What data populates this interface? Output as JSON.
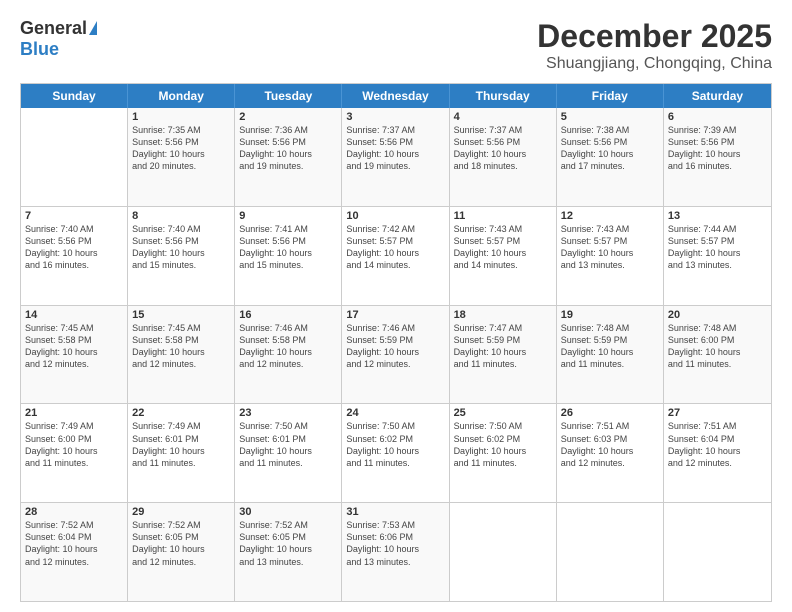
{
  "header": {
    "logo_general": "General",
    "logo_blue": "Blue",
    "month_title": "December 2025",
    "subtitle": "Shuangjiang, Chongqing, China"
  },
  "days_of_week": [
    "Sunday",
    "Monday",
    "Tuesday",
    "Wednesday",
    "Thursday",
    "Friday",
    "Saturday"
  ],
  "weeks": [
    [
      {
        "day": "",
        "info": ""
      },
      {
        "day": "1",
        "info": "Sunrise: 7:35 AM\nSunset: 5:56 PM\nDaylight: 10 hours\nand 20 minutes."
      },
      {
        "day": "2",
        "info": "Sunrise: 7:36 AM\nSunset: 5:56 PM\nDaylight: 10 hours\nand 19 minutes."
      },
      {
        "day": "3",
        "info": "Sunrise: 7:37 AM\nSunset: 5:56 PM\nDaylight: 10 hours\nand 19 minutes."
      },
      {
        "day": "4",
        "info": "Sunrise: 7:37 AM\nSunset: 5:56 PM\nDaylight: 10 hours\nand 18 minutes."
      },
      {
        "day": "5",
        "info": "Sunrise: 7:38 AM\nSunset: 5:56 PM\nDaylight: 10 hours\nand 17 minutes."
      },
      {
        "day": "6",
        "info": "Sunrise: 7:39 AM\nSunset: 5:56 PM\nDaylight: 10 hours\nand 16 minutes."
      }
    ],
    [
      {
        "day": "7",
        "info": "Sunrise: 7:40 AM\nSunset: 5:56 PM\nDaylight: 10 hours\nand 16 minutes."
      },
      {
        "day": "8",
        "info": "Sunrise: 7:40 AM\nSunset: 5:56 PM\nDaylight: 10 hours\nand 15 minutes."
      },
      {
        "day": "9",
        "info": "Sunrise: 7:41 AM\nSunset: 5:56 PM\nDaylight: 10 hours\nand 15 minutes."
      },
      {
        "day": "10",
        "info": "Sunrise: 7:42 AM\nSunset: 5:57 PM\nDaylight: 10 hours\nand 14 minutes."
      },
      {
        "day": "11",
        "info": "Sunrise: 7:43 AM\nSunset: 5:57 PM\nDaylight: 10 hours\nand 14 minutes."
      },
      {
        "day": "12",
        "info": "Sunrise: 7:43 AM\nSunset: 5:57 PM\nDaylight: 10 hours\nand 13 minutes."
      },
      {
        "day": "13",
        "info": "Sunrise: 7:44 AM\nSunset: 5:57 PM\nDaylight: 10 hours\nand 13 minutes."
      }
    ],
    [
      {
        "day": "14",
        "info": "Sunrise: 7:45 AM\nSunset: 5:58 PM\nDaylight: 10 hours\nand 12 minutes."
      },
      {
        "day": "15",
        "info": "Sunrise: 7:45 AM\nSunset: 5:58 PM\nDaylight: 10 hours\nand 12 minutes."
      },
      {
        "day": "16",
        "info": "Sunrise: 7:46 AM\nSunset: 5:58 PM\nDaylight: 10 hours\nand 12 minutes."
      },
      {
        "day": "17",
        "info": "Sunrise: 7:46 AM\nSunset: 5:59 PM\nDaylight: 10 hours\nand 12 minutes."
      },
      {
        "day": "18",
        "info": "Sunrise: 7:47 AM\nSunset: 5:59 PM\nDaylight: 10 hours\nand 11 minutes."
      },
      {
        "day": "19",
        "info": "Sunrise: 7:48 AM\nSunset: 5:59 PM\nDaylight: 10 hours\nand 11 minutes."
      },
      {
        "day": "20",
        "info": "Sunrise: 7:48 AM\nSunset: 6:00 PM\nDaylight: 10 hours\nand 11 minutes."
      }
    ],
    [
      {
        "day": "21",
        "info": "Sunrise: 7:49 AM\nSunset: 6:00 PM\nDaylight: 10 hours\nand 11 minutes."
      },
      {
        "day": "22",
        "info": "Sunrise: 7:49 AM\nSunset: 6:01 PM\nDaylight: 10 hours\nand 11 minutes."
      },
      {
        "day": "23",
        "info": "Sunrise: 7:50 AM\nSunset: 6:01 PM\nDaylight: 10 hours\nand 11 minutes."
      },
      {
        "day": "24",
        "info": "Sunrise: 7:50 AM\nSunset: 6:02 PM\nDaylight: 10 hours\nand 11 minutes."
      },
      {
        "day": "25",
        "info": "Sunrise: 7:50 AM\nSunset: 6:02 PM\nDaylight: 10 hours\nand 11 minutes."
      },
      {
        "day": "26",
        "info": "Sunrise: 7:51 AM\nSunset: 6:03 PM\nDaylight: 10 hours\nand 12 minutes."
      },
      {
        "day": "27",
        "info": "Sunrise: 7:51 AM\nSunset: 6:04 PM\nDaylight: 10 hours\nand 12 minutes."
      }
    ],
    [
      {
        "day": "28",
        "info": "Sunrise: 7:52 AM\nSunset: 6:04 PM\nDaylight: 10 hours\nand 12 minutes."
      },
      {
        "day": "29",
        "info": "Sunrise: 7:52 AM\nSunset: 6:05 PM\nDaylight: 10 hours\nand 12 minutes."
      },
      {
        "day": "30",
        "info": "Sunrise: 7:52 AM\nSunset: 6:05 PM\nDaylight: 10 hours\nand 13 minutes."
      },
      {
        "day": "31",
        "info": "Sunrise: 7:53 AM\nSunset: 6:06 PM\nDaylight: 10 hours\nand 13 minutes."
      },
      {
        "day": "",
        "info": ""
      },
      {
        "day": "",
        "info": ""
      },
      {
        "day": "",
        "info": ""
      }
    ]
  ]
}
